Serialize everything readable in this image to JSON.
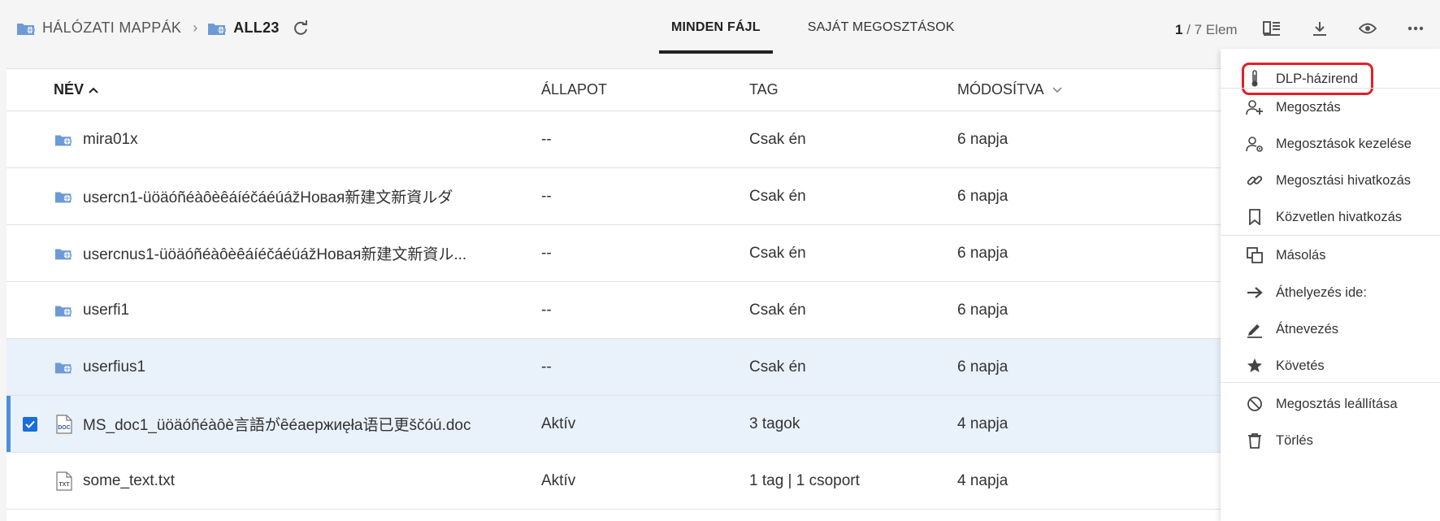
{
  "breadcrumb": {
    "root_label": "HÁLÓZATI MAPPÁK",
    "current_label": "ALL23"
  },
  "tabs": [
    {
      "label": "MINDEN FÁJL",
      "active": true
    },
    {
      "label": "SAJÁT MEGOSZTÁSOK",
      "active": false
    }
  ],
  "item_count": {
    "current": "1",
    "total_text": "/ 7 Elem"
  },
  "toolbar_icons": [
    "details-panel-icon",
    "download-icon",
    "view-icon",
    "more-options-icon"
  ],
  "table": {
    "columns": {
      "name": "NÉV",
      "state": "ÁLLAPOT",
      "tag": "TAG",
      "modified": "MÓDOSÍTVA"
    },
    "rows": [
      {
        "name": "mira01x",
        "type": "network-folder",
        "state": "--",
        "tag": "Csak én",
        "modified": "6 napja"
      },
      {
        "name": "usercn1-üöäóñéàôèêáíéčáéúážНовая新建文新資ルダ",
        "type": "network-folder",
        "state": "--",
        "tag": "Csak én",
        "modified": "6 napja"
      },
      {
        "name": "usercnus1-üöäóñéàôèêáíéčáéúážНовая新建文新資ル...",
        "type": "network-folder",
        "state": "--",
        "tag": "Csak én",
        "modified": "6 napja"
      },
      {
        "name": "userfi1",
        "type": "network-folder",
        "state": "--",
        "tag": "Csak én",
        "modified": "6 napja"
      },
      {
        "name": "userfius1",
        "type": "network-folder",
        "state": "--",
        "tag": "Csak én",
        "modified": "6 napja"
      },
      {
        "name": "MS_doc1_üöäóñéàôè言語がȇéaержиęła语已更ščóú.doc",
        "type": "doc-file",
        "file_badge": "DOC",
        "state": "Aktív",
        "tag": "3 tagok",
        "modified": "4 napja"
      },
      {
        "name": "some_text.txt",
        "type": "txt-file",
        "file_badge": "TXT",
        "state": "Aktív",
        "tag": "1 tag | 1 csoport",
        "modified": "4 napja"
      }
    ]
  },
  "context_menu": {
    "items": [
      {
        "label": "DLP-házirend",
        "icon": "thermometer-icon"
      },
      {
        "label": "Megosztás",
        "icon": "share-user-add-icon"
      },
      {
        "label": "Megosztások kezelése",
        "icon": "manage-shares-icon"
      },
      {
        "label": "Megosztási hivatkozás",
        "icon": "link-icon"
      },
      {
        "label": "Közvetlen hivatkozás",
        "icon": "bookmark-icon"
      },
      {
        "label": "Másolás",
        "icon": "copy-icon"
      },
      {
        "label": "Áthelyezés ide:",
        "icon": "arrow-right-icon"
      },
      {
        "label": "Átnevezés",
        "icon": "pencil-icon"
      },
      {
        "label": "Követés",
        "icon": "star-icon"
      },
      {
        "label": "Megosztás leállítása",
        "icon": "stop-share-icon"
      },
      {
        "label": "Törlés",
        "icon": "trash-icon"
      }
    ]
  },
  "colors": {
    "accent": "#1a6ed8",
    "folder_icon": "#6d9ad6",
    "selected_row": "#e9f1fb",
    "highlight_box": "#e0202a"
  }
}
